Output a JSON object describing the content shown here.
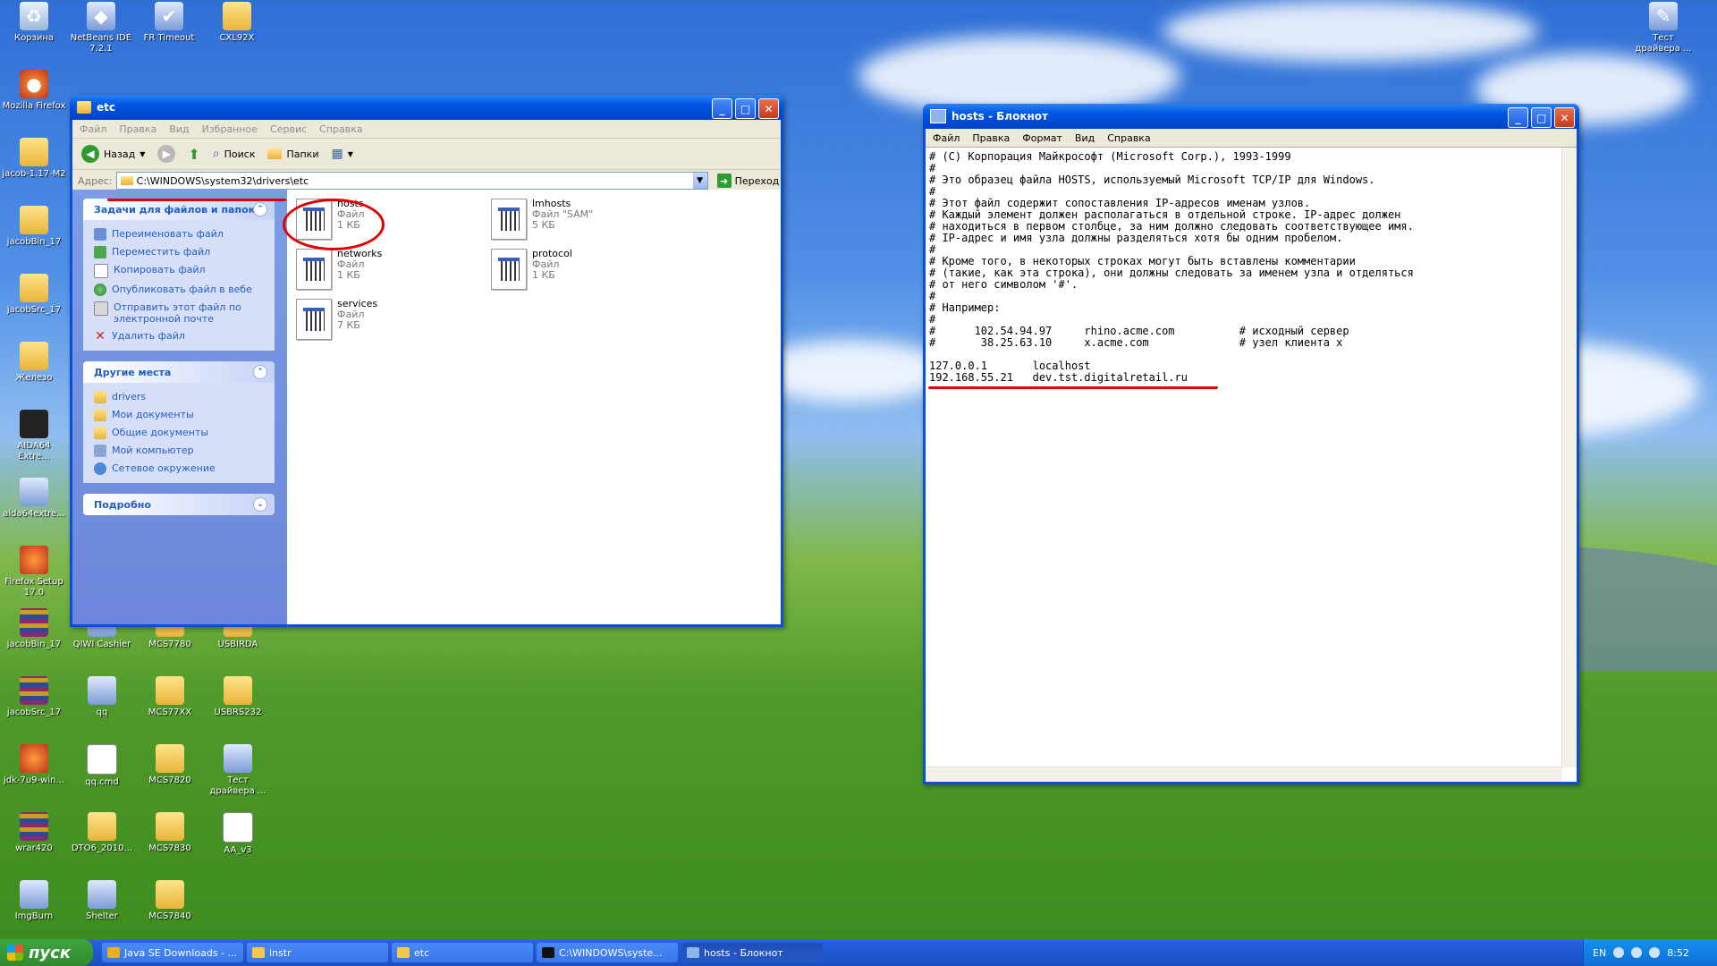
{
  "desktop": {
    "icons_top": [
      {
        "label": "Корзина",
        "glyph": "♻",
        "icon": "recycle-bin-icon"
      },
      {
        "label": "NetBeans IDE 7.2.1",
        "glyph": "◆",
        "icon": "netbeans-icon"
      },
      {
        "label": "FR Timeout",
        "glyph": "✔",
        "icon": "checkmark-icon"
      },
      {
        "label": "CXL92X",
        "glyph": "",
        "icon": "folder-icon"
      },
      {
        "label": "Mozilla Firefox",
        "glyph": "●",
        "icon": "firefox-icon"
      }
    ],
    "icons_left": [
      {
        "label": "jacob-1.17-M2",
        "icon": "folder-icon"
      },
      {
        "label": "jacobBin_17",
        "icon": "folder-icon"
      },
      {
        "label": "jacobSrc_17",
        "icon": "folder-icon"
      },
      {
        "label": "Железо",
        "icon": "folder-icon"
      },
      {
        "label": "AIDA64 Extre...",
        "icon": "aida64-icon"
      },
      {
        "label": "aida64extre...",
        "icon": "installer-icon"
      },
      {
        "label": "Firefox Setup 17.0",
        "icon": "firefox-setup-icon"
      }
    ],
    "icons_grid": [
      {
        "label": "jacobBin_17",
        "icon": "archive-icon"
      },
      {
        "label": "QIWI Cashier",
        "icon": "app-icon"
      },
      {
        "label": "MCS7780",
        "icon": "folder-icon"
      },
      {
        "label": "USBIRDA",
        "icon": "folder-icon"
      },
      {
        "label": "jacobSrc_17",
        "icon": "archive-icon"
      },
      {
        "label": "qq",
        "icon": "app-icon"
      },
      {
        "label": "MCS77XX",
        "icon": "folder-icon"
      },
      {
        "label": "USBRS232",
        "icon": "folder-icon"
      },
      {
        "label": "jdk-7u9-win...",
        "icon": "java-icon"
      },
      {
        "label": "qq.cmd",
        "icon": "file-icon"
      },
      {
        "label": "MCS7820",
        "icon": "folder-icon"
      },
      {
        "label": "Тест драйвера ...",
        "icon": "zebra-icon"
      },
      {
        "label": "wrar420",
        "icon": "archive-icon"
      },
      {
        "label": "DTO6_2010...",
        "icon": "folder-icon"
      },
      {
        "label": "MCS7830",
        "icon": "folder-icon"
      },
      {
        "label": "AA_v3",
        "icon": "file-icon"
      },
      {
        "label": "ImgBurn",
        "icon": "disc-icon"
      },
      {
        "label": "Shelter",
        "icon": "app-icon"
      },
      {
        "label": "MCS7840",
        "icon": "folder-icon"
      }
    ],
    "icon_topright": {
      "label": "Тест драйвера ...",
      "icon": "zebra-icon"
    }
  },
  "explorer": {
    "title": "etc",
    "menu": [
      "Файл",
      "Правка",
      "Вид",
      "Избранное",
      "Сервис",
      "Справка"
    ],
    "toolbar": {
      "back": "Назад",
      "search": "Поиск",
      "folders": "Папки"
    },
    "address_label": "Адрес:",
    "address": "C:\\WINDOWS\\system32\\drivers\\etc",
    "go": "Переход",
    "tasks_panel": {
      "title": "Задачи для файлов и папок",
      "items": [
        "Переименовать файл",
        "Переместить файл",
        "Копировать файл",
        "Опубликовать файл в вебе",
        "Отправить этот файл по электронной почте",
        "Удалить файл"
      ]
    },
    "places_panel": {
      "title": "Другие места",
      "items": [
        "drivers",
        "Мои документы",
        "Общие документы",
        "Мой компьютер",
        "Сетевое окружение"
      ]
    },
    "details_panel": {
      "title": "Подробно"
    },
    "files": [
      {
        "name": "hosts",
        "type": "Файл",
        "size": "1 КБ"
      },
      {
        "name": "lmhosts",
        "type": "Файл \"SAM\"",
        "size": "5 КБ"
      },
      {
        "name": "networks",
        "type": "Файл",
        "size": "1 КБ"
      },
      {
        "name": "protocol",
        "type": "Файл",
        "size": "1 КБ"
      },
      {
        "name": "services",
        "type": "Файл",
        "size": "7 КБ"
      }
    ]
  },
  "notepad": {
    "title": "hosts - Блокнот",
    "menu": [
      "Файл",
      "Правка",
      "Формат",
      "Вид",
      "Справка"
    ],
    "text": "# (C) Корпорация Майкрософт (Microsoft Corp.), 1993-1999\n#\n# Это образец файла HOSTS, используемый Microsoft TCP/IP для Windows.\n#\n# Этот файл содержит сопоставления IP-адресов именам узлов.\n# Каждый элемент должен располагаться в отдельной строке. IP-адрес должен\n# находиться в первом столбце, за ним должно следовать соответствующее имя.\n# IP-адрес и имя узла должны разделяться хотя бы одним пробелом.\n#\n# Кроме того, в некоторых строках могут быть вставлены комментарии\n# (такие, как эта строка), они должны следовать за именем узла и отделяться\n# от него символом '#'.\n#\n# Например:\n#\n#      102.54.94.97     rhino.acme.com          # исходный сервер\n#       38.25.63.10     x.acme.com              # узел клиента x\n\n127.0.0.1       localhost\n192.168.55.21   dev.tst.digitalretail.ru"
  },
  "taskbar": {
    "start": "пуск",
    "tasks": [
      {
        "label": "Java SE Downloads - ...",
        "icon": "chrome-icon",
        "color": "#e8b020"
      },
      {
        "label": "instr",
        "icon": "folder-icon",
        "color": "#f2c94c"
      },
      {
        "label": "etc",
        "icon": "folder-icon",
        "color": "#f2c94c"
      },
      {
        "label": "C:\\WINDOWS\\syste...",
        "icon": "cmd-icon",
        "color": "#111111"
      },
      {
        "label": "hosts - Блокнот",
        "icon": "notepad-icon",
        "color": "#8fb4e8"
      }
    ],
    "lang": "EN",
    "clock": "8:52"
  },
  "colors": {
    "annotation": "#e00000",
    "xp_blue": "#0054e3",
    "task_link": "#215dc6"
  }
}
